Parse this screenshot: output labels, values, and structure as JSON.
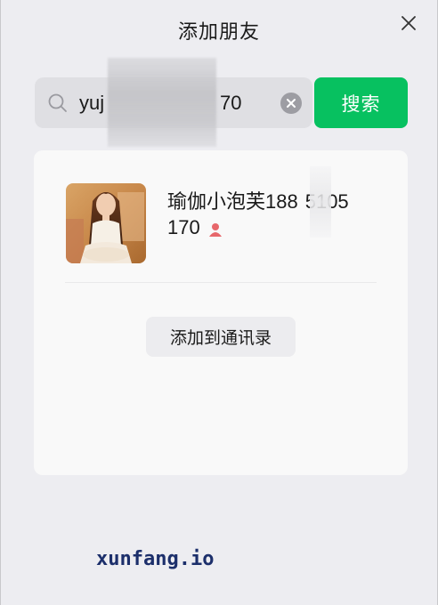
{
  "dialog": {
    "title": "添加朋友",
    "close_icon": "close-icon"
  },
  "search": {
    "icon": "search-icon",
    "value_visible_start": "yuj",
    "value_visible_end": "70",
    "clear_icon": "clear-icon",
    "button_label": "搜索",
    "button_color": "#07c160"
  },
  "result": {
    "avatar_icon": "avatar",
    "name_line1": "瑜伽小泡芙188",
    "name_line1_tail": "5105",
    "name_line2": "170",
    "gender_icon": "female-icon",
    "gender_color": "#e7676b",
    "add_button_label": "添加到通讯录"
  },
  "watermark": {
    "text": "xunfang.io"
  }
}
